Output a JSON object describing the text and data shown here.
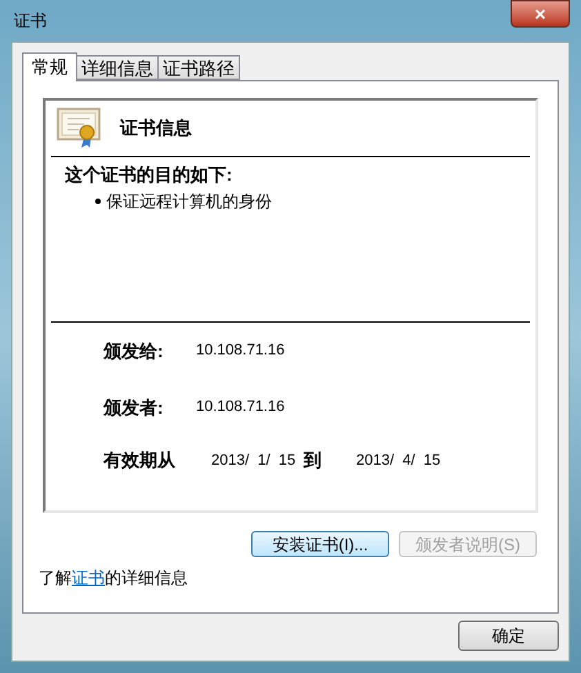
{
  "window": {
    "title": "证书",
    "close": "×"
  },
  "tabs": [
    {
      "label": "常规",
      "selected": true
    },
    {
      "label": "详细信息",
      "selected": false
    },
    {
      "label": "证书路径",
      "selected": false
    }
  ],
  "cert_info": {
    "heading": "证书信息",
    "purpose_title": "这个证书的目的如下:",
    "purposes": [
      "保证远程计算机的身份"
    ],
    "issued_to_label": "颁发给:",
    "issued_to": "10.108.71.16",
    "issued_by_label": "颁发者:",
    "issued_by": "10.108.71.16",
    "valid_label": "有效期从",
    "valid_from": "2013/  1/  15",
    "to_label": "到",
    "valid_to": "2013/  4/  15"
  },
  "actions": [
    {
      "label": "安装证书(I)...",
      "disabled": false
    },
    {
      "label": "颁发者说明(S)",
      "disabled": true
    }
  ],
  "learn_more": {
    "prefix": "了解",
    "link": "证书",
    "suffix": "的详细信息"
  },
  "ok_button": "确定"
}
